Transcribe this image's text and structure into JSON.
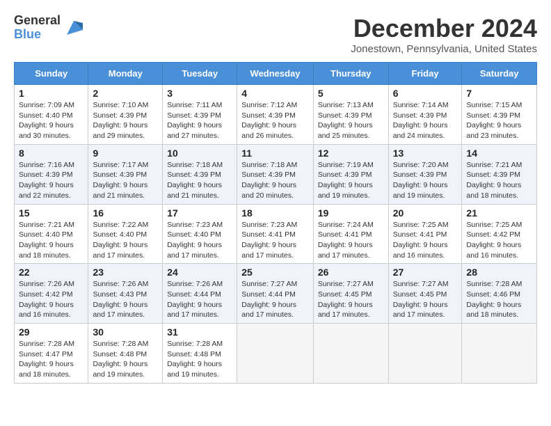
{
  "logo": {
    "general": "General",
    "blue": "Blue"
  },
  "title": "December 2024",
  "location": "Jonestown, Pennsylvania, United States",
  "days_of_week": [
    "Sunday",
    "Monday",
    "Tuesday",
    "Wednesday",
    "Thursday",
    "Friday",
    "Saturday"
  ],
  "weeks": [
    [
      {
        "day": "1",
        "sunrise": "7:09 AM",
        "sunset": "4:40 PM",
        "daylight": "9 hours and 30 minutes."
      },
      {
        "day": "2",
        "sunrise": "7:10 AM",
        "sunset": "4:39 PM",
        "daylight": "9 hours and 29 minutes."
      },
      {
        "day": "3",
        "sunrise": "7:11 AM",
        "sunset": "4:39 PM",
        "daylight": "9 hours and 27 minutes."
      },
      {
        "day": "4",
        "sunrise": "7:12 AM",
        "sunset": "4:39 PM",
        "daylight": "9 hours and 26 minutes."
      },
      {
        "day": "5",
        "sunrise": "7:13 AM",
        "sunset": "4:39 PM",
        "daylight": "9 hours and 25 minutes."
      },
      {
        "day": "6",
        "sunrise": "7:14 AM",
        "sunset": "4:39 PM",
        "daylight": "9 hours and 24 minutes."
      },
      {
        "day": "7",
        "sunrise": "7:15 AM",
        "sunset": "4:39 PM",
        "daylight": "9 hours and 23 minutes."
      }
    ],
    [
      {
        "day": "8",
        "sunrise": "7:16 AM",
        "sunset": "4:39 PM",
        "daylight": "9 hours and 22 minutes."
      },
      {
        "day": "9",
        "sunrise": "7:17 AM",
        "sunset": "4:39 PM",
        "daylight": "9 hours and 21 minutes."
      },
      {
        "day": "10",
        "sunrise": "7:18 AM",
        "sunset": "4:39 PM",
        "daylight": "9 hours and 21 minutes."
      },
      {
        "day": "11",
        "sunrise": "7:18 AM",
        "sunset": "4:39 PM",
        "daylight": "9 hours and 20 minutes."
      },
      {
        "day": "12",
        "sunrise": "7:19 AM",
        "sunset": "4:39 PM",
        "daylight": "9 hours and 19 minutes."
      },
      {
        "day": "13",
        "sunrise": "7:20 AM",
        "sunset": "4:39 PM",
        "daylight": "9 hours and 19 minutes."
      },
      {
        "day": "14",
        "sunrise": "7:21 AM",
        "sunset": "4:39 PM",
        "daylight": "9 hours and 18 minutes."
      }
    ],
    [
      {
        "day": "15",
        "sunrise": "7:21 AM",
        "sunset": "4:40 PM",
        "daylight": "9 hours and 18 minutes."
      },
      {
        "day": "16",
        "sunrise": "7:22 AM",
        "sunset": "4:40 PM",
        "daylight": "9 hours and 17 minutes."
      },
      {
        "day": "17",
        "sunrise": "7:23 AM",
        "sunset": "4:40 PM",
        "daylight": "9 hours and 17 minutes."
      },
      {
        "day": "18",
        "sunrise": "7:23 AM",
        "sunset": "4:41 PM",
        "daylight": "9 hours and 17 minutes."
      },
      {
        "day": "19",
        "sunrise": "7:24 AM",
        "sunset": "4:41 PM",
        "daylight": "9 hours and 17 minutes."
      },
      {
        "day": "20",
        "sunrise": "7:25 AM",
        "sunset": "4:41 PM",
        "daylight": "9 hours and 16 minutes."
      },
      {
        "day": "21",
        "sunrise": "7:25 AM",
        "sunset": "4:42 PM",
        "daylight": "9 hours and 16 minutes."
      }
    ],
    [
      {
        "day": "22",
        "sunrise": "7:26 AM",
        "sunset": "4:42 PM",
        "daylight": "9 hours and 16 minutes."
      },
      {
        "day": "23",
        "sunrise": "7:26 AM",
        "sunset": "4:43 PM",
        "daylight": "9 hours and 17 minutes."
      },
      {
        "day": "24",
        "sunrise": "7:26 AM",
        "sunset": "4:44 PM",
        "daylight": "9 hours and 17 minutes."
      },
      {
        "day": "25",
        "sunrise": "7:27 AM",
        "sunset": "4:44 PM",
        "daylight": "9 hours and 17 minutes."
      },
      {
        "day": "26",
        "sunrise": "7:27 AM",
        "sunset": "4:45 PM",
        "daylight": "9 hours and 17 minutes."
      },
      {
        "day": "27",
        "sunrise": "7:27 AM",
        "sunset": "4:45 PM",
        "daylight": "9 hours and 17 minutes."
      },
      {
        "day": "28",
        "sunrise": "7:28 AM",
        "sunset": "4:46 PM",
        "daylight": "9 hours and 18 minutes."
      }
    ],
    [
      {
        "day": "29",
        "sunrise": "7:28 AM",
        "sunset": "4:47 PM",
        "daylight": "9 hours and 18 minutes."
      },
      {
        "day": "30",
        "sunrise": "7:28 AM",
        "sunset": "4:48 PM",
        "daylight": "9 hours and 19 minutes."
      },
      {
        "day": "31",
        "sunrise": "7:28 AM",
        "sunset": "4:48 PM",
        "daylight": "9 hours and 19 minutes."
      },
      null,
      null,
      null,
      null
    ]
  ],
  "labels": {
    "sunrise": "Sunrise:",
    "sunset": "Sunset:",
    "daylight": "Daylight:"
  }
}
